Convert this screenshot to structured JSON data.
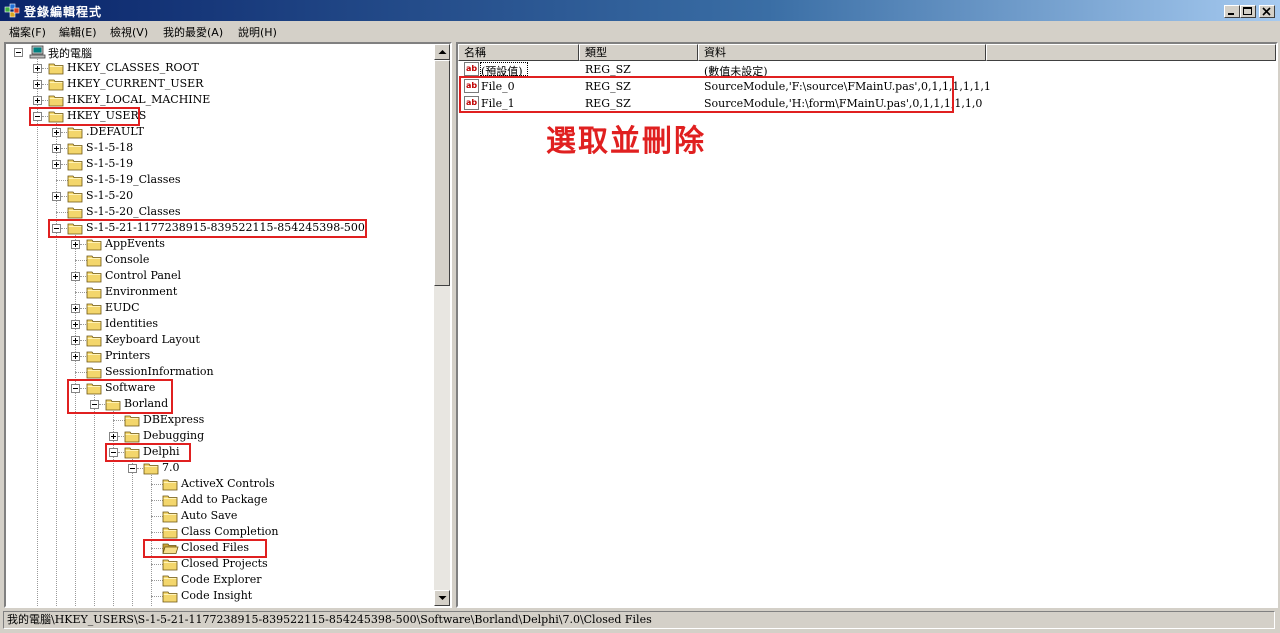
{
  "window": {
    "title": "登錄編輯程式"
  },
  "menu": [
    "檔案(F)",
    "編輯(E)",
    "檢視(V)",
    "我的最愛(A)",
    "說明(H)"
  ],
  "tree": [
    {
      "label": "我的電腦",
      "depth": 0,
      "expander": "minus",
      "icon": "computer-icon"
    },
    {
      "label": "HKEY_CLASSES_ROOT",
      "depth": 1,
      "expander": "plus"
    },
    {
      "label": "HKEY_CURRENT_USER",
      "depth": 1,
      "expander": "plus"
    },
    {
      "label": "HKEY_LOCAL_MACHINE",
      "depth": 1,
      "expander": "plus"
    },
    {
      "label": "HKEY_USERS",
      "depth": 1,
      "expander": "minus",
      "highlight": true
    },
    {
      "label": ".DEFAULT",
      "depth": 2,
      "expander": "plus"
    },
    {
      "label": "S-1-5-18",
      "depth": 2,
      "expander": "plus"
    },
    {
      "label": "S-1-5-19",
      "depth": 2,
      "expander": "plus"
    },
    {
      "label": "S-1-5-19_Classes",
      "depth": 2,
      "expander": "none"
    },
    {
      "label": "S-1-5-20",
      "depth": 2,
      "expander": "plus"
    },
    {
      "label": "S-1-5-20_Classes",
      "depth": 2,
      "expander": "none"
    },
    {
      "label": "S-1-5-21-1177238915-839522115-854245398-500",
      "depth": 2,
      "expander": "minus",
      "highlight": true
    },
    {
      "label": "AppEvents",
      "depth": 3,
      "expander": "plus"
    },
    {
      "label": "Console",
      "depth": 3,
      "expander": "none"
    },
    {
      "label": "Control Panel",
      "depth": 3,
      "expander": "plus"
    },
    {
      "label": "Environment",
      "depth": 3,
      "expander": "none"
    },
    {
      "label": "EUDC",
      "depth": 3,
      "expander": "plus"
    },
    {
      "label": "Identities",
      "depth": 3,
      "expander": "plus"
    },
    {
      "label": "Keyboard Layout",
      "depth": 3,
      "expander": "plus"
    },
    {
      "label": "Printers",
      "depth": 3,
      "expander": "plus"
    },
    {
      "label": "SessionInformation",
      "depth": 3,
      "expander": "none"
    },
    {
      "label": "Software",
      "depth": 3,
      "expander": "minus",
      "highlight": true
    },
    {
      "label": "Borland",
      "depth": 4,
      "expander": "minus",
      "highlight": true
    },
    {
      "label": "DBExpress",
      "depth": 5,
      "expander": "none"
    },
    {
      "label": "Debugging",
      "depth": 5,
      "expander": "plus"
    },
    {
      "label": "Delphi",
      "depth": 5,
      "expander": "minus",
      "highlight": true
    },
    {
      "label": "7.0",
      "depth": 6,
      "expander": "minus"
    },
    {
      "label": "ActiveX Controls",
      "depth": 7,
      "expander": "none"
    },
    {
      "label": "Add to Package",
      "depth": 7,
      "expander": "none"
    },
    {
      "label": "Auto Save",
      "depth": 7,
      "expander": "none"
    },
    {
      "label": "Class Completion",
      "depth": 7,
      "expander": "none"
    },
    {
      "label": "Closed Files",
      "depth": 7,
      "expander": "none",
      "highlight": true,
      "open": true
    },
    {
      "label": "Closed Projects",
      "depth": 7,
      "expander": "none"
    },
    {
      "label": "Code Explorer",
      "depth": 7,
      "expander": "none"
    },
    {
      "label": "Code Insight",
      "depth": 7,
      "expander": "none"
    }
  ],
  "list": {
    "columns": [
      "名稱",
      "類型",
      "資料"
    ],
    "rows": [
      {
        "name": "(預設值)",
        "type": "REG_SZ",
        "data": "(數值未設定)",
        "highlight": false
      },
      {
        "name": "File_0",
        "type": "REG_SZ",
        "data": "SourceModule,'F:\\source\\FMainU.pas',0,1,1,1,1,1,1",
        "highlight": true
      },
      {
        "name": "File_1",
        "type": "REG_SZ",
        "data": "SourceModule,'H:\\form\\FMainU.pas',0,1,1,1,1,1,0",
        "highlight": true
      }
    ],
    "icon_text": "ab"
  },
  "annotation": "選取並刪除",
  "statusbar": "我的電腦\\HKEY_USERS\\S-1-5-21-1177238915-839522115-854245398-500\\Software\\Borland\\Delphi\\7.0\\Closed Files",
  "colors": {
    "highlight_box": "#e02020",
    "titlebar": "#0a246a",
    "chrome": "#d4d0c8"
  }
}
